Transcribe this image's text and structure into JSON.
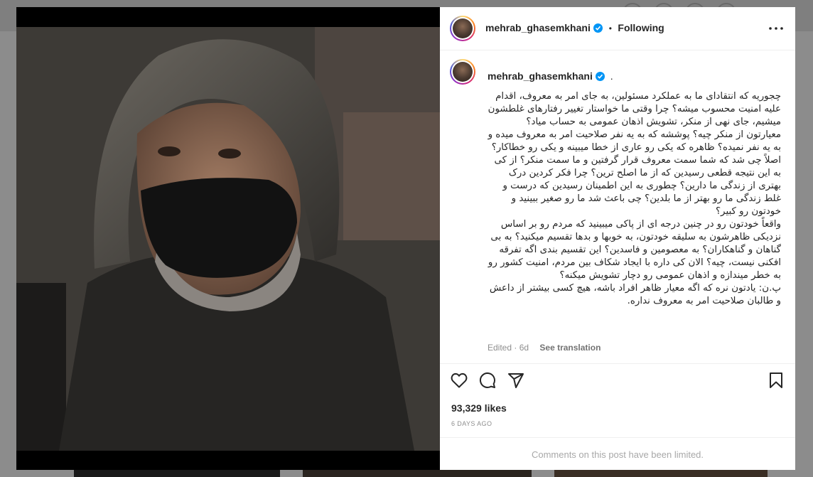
{
  "post_header": {
    "username": "mehrab_ghasemkhani",
    "separator": "•",
    "follow_status": "Following",
    "more_icon": "more-horizontal-icon"
  },
  "caption": {
    "username": "mehrab_ghasemkhani",
    "trailing": ".",
    "text": "چجوریه که انتقادای ما به عملکرد مسئولین، به جای امر به معروف، اقدام علیه امنیت محسوب میشه؟ چرا وقتی ما خواستار تغییر رفتارهای غلطشون میشیم، جای نهی از منکر، تشویش اذهان عمومی به حساب میاد؟\nمعیارتون از منکر چیه؟ پوششه که به یه نفر صلاحیت امر به معروف میده و به یه نفر نمیده؟ ظاهره که یکی رو عاری از خطا میبینه و یکی رو خطاکار؟\nاصلاً چی شد که شما سمت معروف قرار گرفتین و ما سمت منکر؟ از کی به این نتیجه قطعی رسیدین که از ما اصلح ترین؟ چرا فکر کردین درک بهتری از زندگی ما دارین؟ چطوری به این اطمینان رسیدین که درست و غلط زندگی ما رو بهتر از ما بلدین؟ چی باعث شد ما رو صغیر ببینید و خودتون رو کبیر؟\nواقعاً خودتون رو در چنین درجه ای از پاکی میبینید که مردم رو بر اساس نزدیکی ظاهرشون به سلیقه خودتون، به خوبها و بدها تقسیم میکنید؟ به بی گناهان و گناهکاران؟ به معصومین و فاسدین؟ این تقسیم بندی اگه تفرقه افکنی نیست، چیه؟ الان کی داره با ایجاد شکاف بین مردم، امنیت کشور رو به خطر میندازه و اذهان عمومی رو دچار تشویش میکنه؟\nپ.ن: یادتون نره که اگه معیار ظاهر افراد باشه، هیچ کسی بیشتر از داعش و طالبان صلاحیت امر به معروف نداره.",
    "edited": "Edited · 6d",
    "see_translation": "See translation"
  },
  "actions": {
    "like_icon": "heart-icon",
    "comment_icon": "comment-icon",
    "share_icon": "share-icon",
    "save_icon": "bookmark-icon"
  },
  "likes": "93,329 likes",
  "post_date": "6 DAYS AGO",
  "comments_notice": "Comments on this post have been limited."
}
